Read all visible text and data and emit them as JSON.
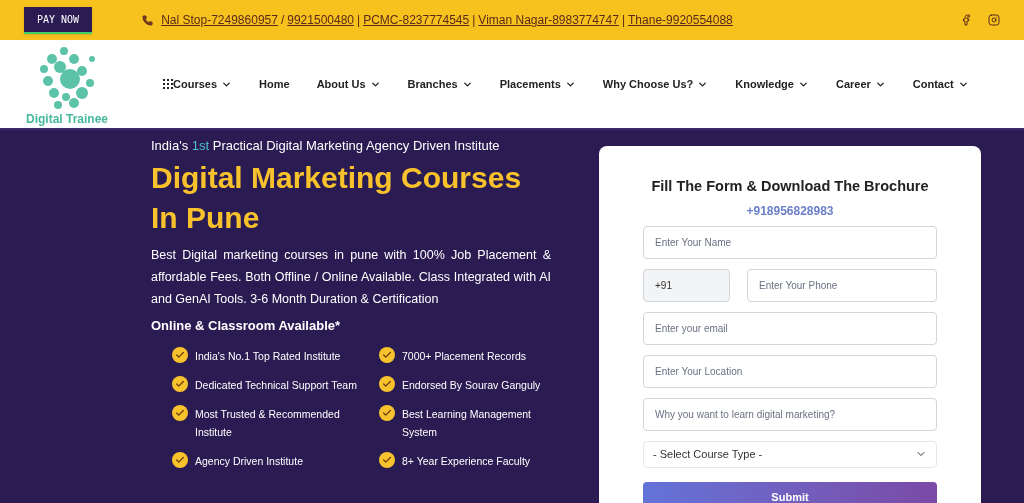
{
  "top_bar": {
    "pay_button": "PAY NOW",
    "contacts": [
      {
        "kind": "link",
        "text": "Nal Stop-7249860957"
      },
      {
        "kind": "separator",
        "text": "/"
      },
      {
        "kind": "link",
        "text": "9921500480"
      },
      {
        "kind": "separator",
        "text": "|"
      },
      {
        "kind": "link",
        "text": "PCMC-8237774545"
      },
      {
        "kind": "separator",
        "text": "|"
      },
      {
        "kind": "link",
        "text": "Viman Nagar-8983774747"
      },
      {
        "kind": "separator",
        "text": "|"
      },
      {
        "kind": "link",
        "text": "Thane-9920554088"
      }
    ]
  },
  "logo": {
    "text": "Digital Trainee"
  },
  "nav": [
    {
      "label": "Courses",
      "grid_icon": true,
      "dropdown": true
    },
    {
      "label": "Home",
      "grid_icon": false,
      "dropdown": false
    },
    {
      "label": "About Us",
      "grid_icon": false,
      "dropdown": true
    },
    {
      "label": "Branches",
      "grid_icon": false,
      "dropdown": true
    },
    {
      "label": "Placements",
      "grid_icon": false,
      "dropdown": true
    },
    {
      "label": "Why Choose Us?",
      "grid_icon": false,
      "dropdown": true
    },
    {
      "label": "Knowledge",
      "grid_icon": false,
      "dropdown": true
    },
    {
      "label": "Career",
      "grid_icon": false,
      "dropdown": true
    },
    {
      "label": "Contact",
      "grid_icon": false,
      "dropdown": true
    }
  ],
  "hero": {
    "tagline": {
      "before": "India's ",
      "highlight": "1st",
      "after": " Practical Digital Marketing Agency Driven Institute"
    },
    "title": "Digital Marketing Courses In Pune",
    "description": "Best Digital marketing courses in pune with 100% Job Placement & affordable Fees. Both Offline / Online Available. Class Integrated with AI and GenAI Tools. 3-6 Month Duration & Certification",
    "subtitle": "Online & Classroom Available*",
    "features": [
      "India's No.1 Top Rated Institute",
      "7000+ Placement Records",
      "Dedicated Technical Support Team",
      "Endorsed By Sourav Ganguly",
      "Most Trusted & Recommended Institute",
      "Best Learning Management System",
      "Agency Driven Institute",
      "8+ Year Experience Faculty"
    ]
  },
  "form": {
    "title": "Fill The Form & Download The Brochure",
    "phone": "+918956828983",
    "name_placeholder": "Enter Your Name",
    "country_code": "+91",
    "phone_placeholder": "Enter Your Phone",
    "email_placeholder": "Enter your email",
    "location_placeholder": "Enter Your Location",
    "reason_placeholder": "Why you want to learn digital marketing?",
    "course_select": "- Select Course Type -",
    "submit": "Submit"
  }
}
